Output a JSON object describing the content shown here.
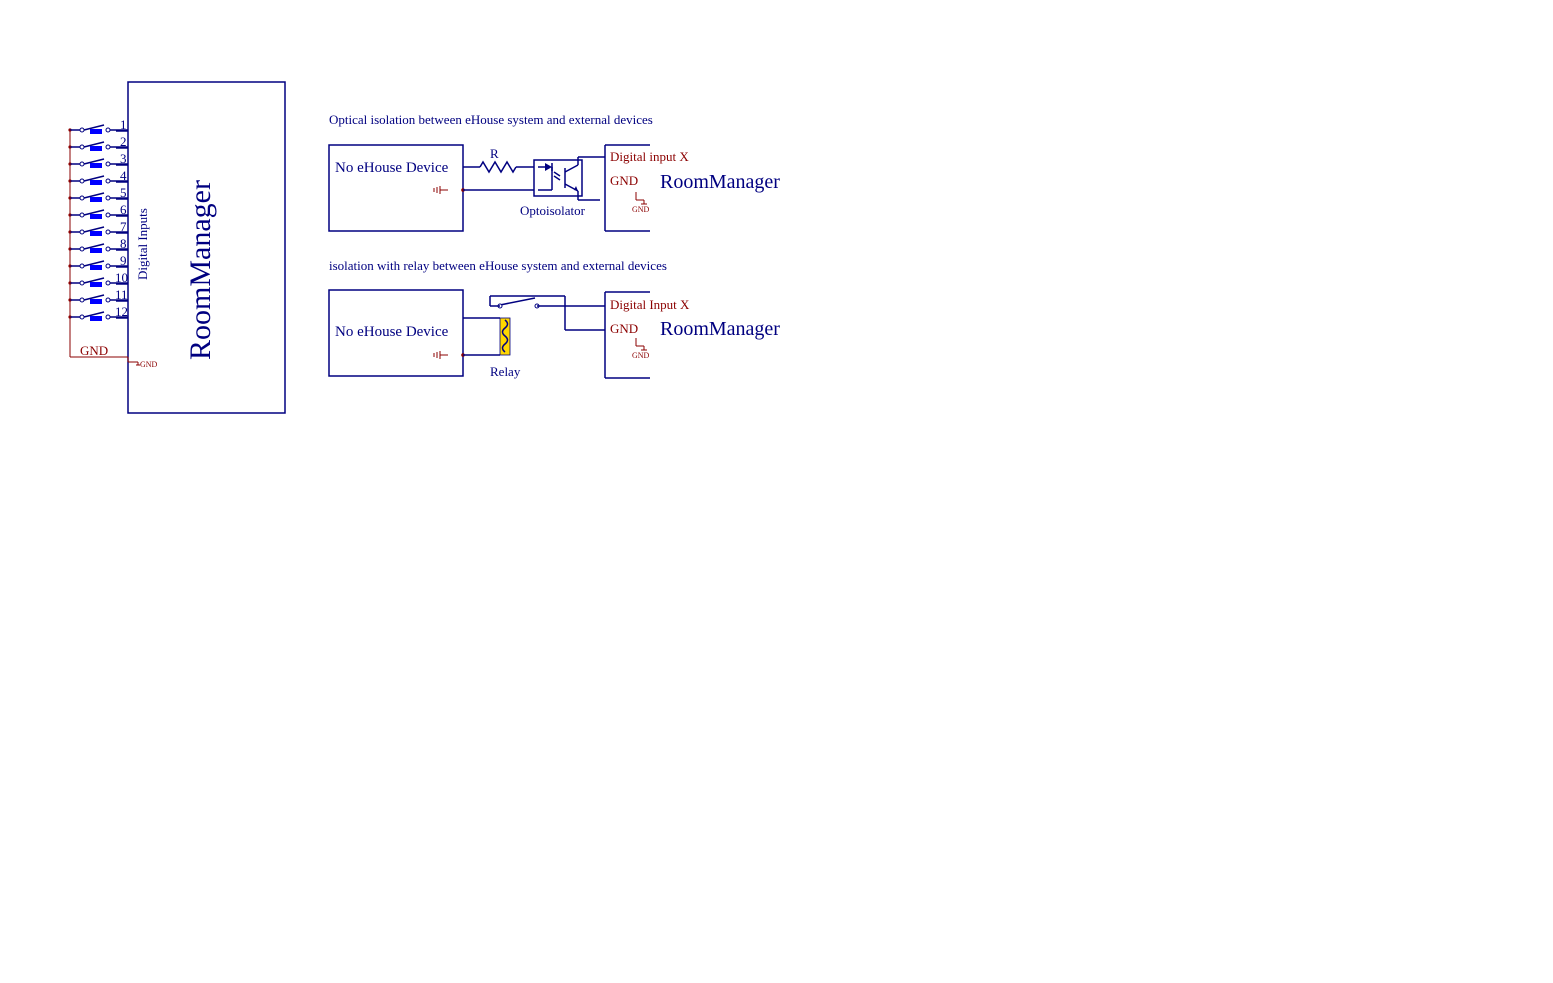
{
  "main": {
    "title": "RoomManager",
    "inputs_label": "Digital Inputs",
    "pin_count": 12,
    "gnd_label": "GND",
    "gnd_small": "GND"
  },
  "opto": {
    "caption": "Optical isolation between eHouse system and external devices",
    "device_label": "No eHouse Device",
    "resistor_label": "R",
    "component_label": "Optoisolator",
    "pin_label": "Digital input X",
    "gnd_label": "GND",
    "gnd_small": "GND",
    "title": "RoomManager"
  },
  "relay": {
    "caption": "isolation with relay between eHouse system and external devices",
    "device_label": "No eHouse Device",
    "component_label": "Relay",
    "pin_label": "Digital Input X",
    "gnd_label": "GND",
    "gnd_small": "GND",
    "title": "RoomManager"
  }
}
